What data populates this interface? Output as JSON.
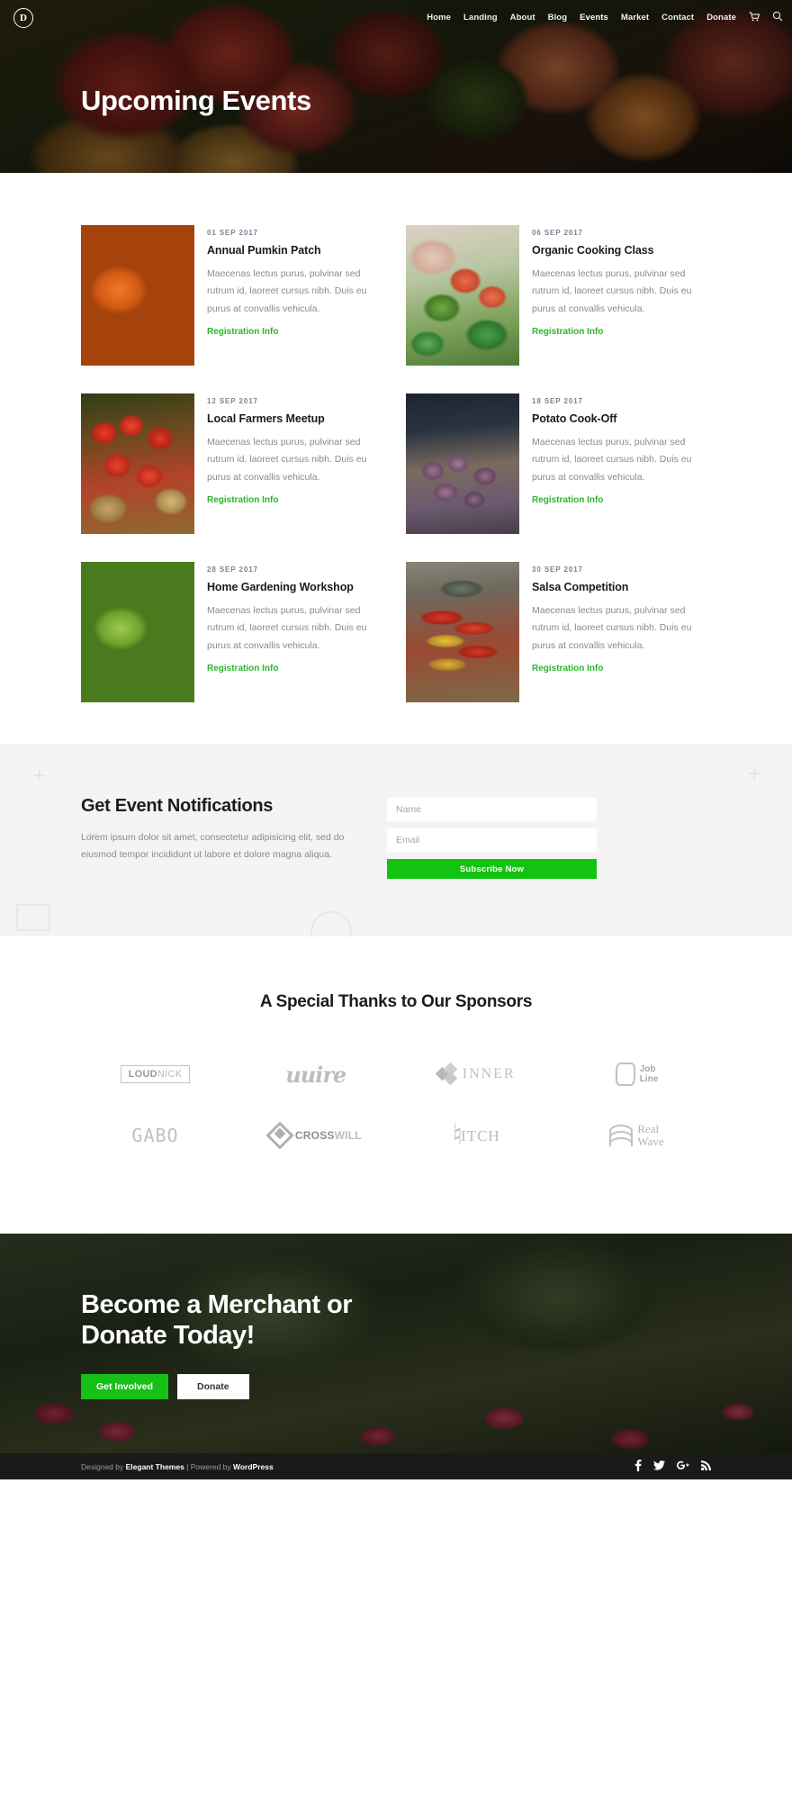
{
  "header": {
    "logo_letter": "D",
    "nav": [
      {
        "label": "Home",
        "active": false
      },
      {
        "label": "Landing",
        "active": false
      },
      {
        "label": "About",
        "active": false
      },
      {
        "label": "Blog",
        "active": false
      },
      {
        "label": "Events",
        "active": true
      },
      {
        "label": "Market",
        "active": false
      },
      {
        "label": "Contact",
        "active": false
      },
      {
        "label": "Donate",
        "active": false
      }
    ],
    "cart_icon": "Ὥ2",
    "search_icon": "⚲",
    "page_title": "Upcoming Events"
  },
  "events": [
    {
      "date": "01 SEP 2017",
      "title": "Annual Pumkin Patch",
      "text": "Maecenas lectus purus, pulvinar sed rutrum id, laoreet cursus nibh. Duis eu purus at convallis vehicula.",
      "link": "Registration Info",
      "image": "pumpkin-patch-photo"
    },
    {
      "date": "06 SEP 2017",
      "title": "Organic Cooking Class",
      "text": "Maecenas lectus purus, pulvinar sed rutrum id, laoreet cursus nibh. Duis eu purus at convallis vehicula.",
      "link": "Registration Info",
      "image": "market-vegetables-photo"
    },
    {
      "date": "12 SEP 2017",
      "title": "Local Farmers Meetup",
      "text": "Maecenas lectus purus, pulvinar sed rutrum id, laoreet cursus nibh. Duis eu purus at convallis vehicula.",
      "link": "Registration Info",
      "image": "tomato-baskets-photo"
    },
    {
      "date": "18 SEP 2017",
      "title": "Potato Cook-Off",
      "text": "Maecenas lectus purus, pulvinar sed rutrum id, laoreet cursus nibh. Duis eu purus at convallis vehicula.",
      "link": "Registration Info",
      "image": "purple-potatoes-photo"
    },
    {
      "date": "28 SEP 2017",
      "title": "Home Gardening Workshop",
      "text": "Maecenas lectus purus, pulvinar sed rutrum id, laoreet cursus nibh. Duis eu purus at convallis vehicula.",
      "link": "Registration Info",
      "image": "lettuce-garden-photo"
    },
    {
      "date": "30 SEP 2017",
      "title": "Salsa Competition",
      "text": "Maecenas lectus purus, pulvinar sed rutrum id, laoreet cursus nibh. Duis eu purus at convallis vehicula.",
      "link": "Registration Info",
      "image": "peppers-crate-photo"
    }
  ],
  "signup": {
    "title": "Get Event Notifications",
    "text": "Lorem ipsum dolor sit amet, consectetur adipisicing elit, sed do eiusmod tempor incididunt ut labore et dolore magna aliqua.",
    "name_placeholder": "Name",
    "name_value": "",
    "email_placeholder": "Email",
    "email_value": "",
    "subscribe_label": "Subscribe Now",
    "subscribe_color": "#13c312"
  },
  "sponsors": {
    "title": "A Special Thanks to Our Sponsors",
    "rows": [
      [
        {
          "name": "LOUDNICK",
          "bold_part": "LOUD",
          "light_part": "NICK"
        },
        {
          "name": "uuire"
        },
        {
          "name": "INNER"
        },
        {
          "name": "Job Line",
          "line1": "Job",
          "line2": "Line"
        }
      ],
      [
        {
          "name": "GABO"
        },
        {
          "name": "CROSSWILL",
          "bold_part": "CROSS",
          "light_part": "WILL"
        },
        {
          "name": "PITCH",
          "text_part": "ITCH"
        },
        {
          "name": "Real Wave",
          "line1": "Real",
          "line2": "Wave"
        }
      ]
    ]
  },
  "cta": {
    "title_line1": "Become a Merchant or",
    "title_line2": "Donate Today!",
    "primary_label": "Get Involved",
    "secondary_label": "Donate",
    "primary_color": "#16c016"
  },
  "footer": {
    "prefix": "Designed by ",
    "brand": "Elegant Themes",
    "middle": " | Powered by ",
    "platform": "WordPress",
    "social": [
      {
        "name": "facebook-icon",
        "glyph": "f"
      },
      {
        "name": "twitter-icon",
        "glyph": "ᵗ"
      },
      {
        "name": "google-plus-icon",
        "glyph": "G+"
      },
      {
        "name": "rss-icon",
        "glyph": "◔"
      }
    ]
  }
}
